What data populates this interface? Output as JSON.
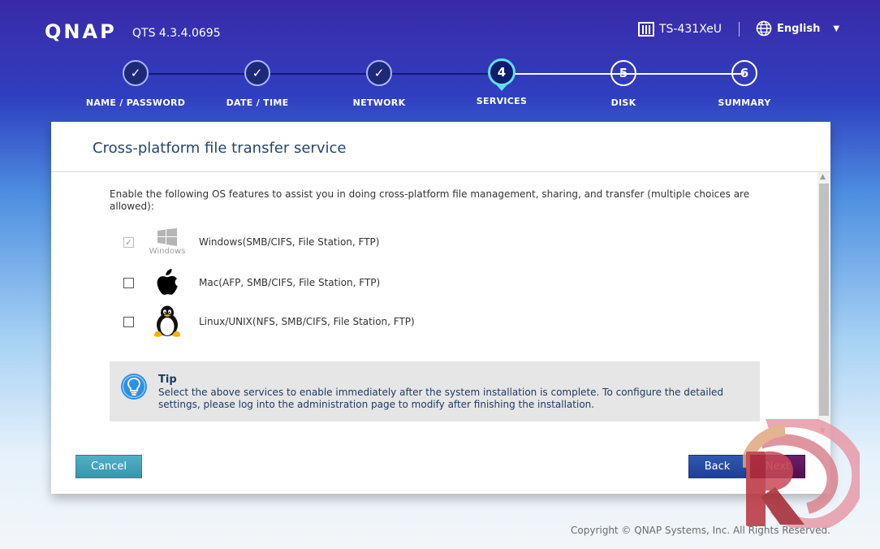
{
  "header": {
    "logo": "QNAP",
    "version": "QTS 4.3.4.0695",
    "device": "TS-431XeU",
    "language": "English"
  },
  "steps": [
    {
      "label": "NAME / PASSWORD",
      "state": "done",
      "mark": "✓"
    },
    {
      "label": "DATE / TIME",
      "state": "done",
      "mark": "✓"
    },
    {
      "label": "NETWORK",
      "state": "done",
      "mark": "✓"
    },
    {
      "label": "SERVICES",
      "state": "active",
      "mark": "4"
    },
    {
      "label": "DISK",
      "state": "todo",
      "mark": "5"
    },
    {
      "label": "SUMMARY",
      "state": "todo",
      "mark": "6"
    }
  ],
  "panel": {
    "title": "Cross-platform file transfer service",
    "intro": "Enable the following OS features to assist you in doing cross-platform file management, sharing, and transfer (multiple choices are allowed):",
    "options": [
      {
        "label": "Windows(SMB/CIFS, File Station, FTP)",
        "checked": true,
        "disabled": true,
        "icon": "windows-icon",
        "caption": "Windows"
      },
      {
        "label": "Mac(AFP, SMB/CIFS, File Station, FTP)",
        "checked": false,
        "disabled": false,
        "icon": "apple-icon"
      },
      {
        "label": "Linux/UNIX(NFS, SMB/CIFS, File Station, FTP)",
        "checked": false,
        "disabled": false,
        "icon": "tux-icon"
      }
    ],
    "tip": {
      "title": "Tip",
      "text": "Select the above services to enable immediately after the system installation is complete. To configure the detailed settings, please log into the administration page to modify after finishing the installation."
    }
  },
  "buttons": {
    "cancel": "Cancel",
    "back": "Back",
    "next": "Next"
  },
  "footer": {
    "copyright": "Copyright © QNAP Systems, Inc. All Rights Reserved."
  },
  "colors": {
    "accent_active": "#5ee0f0",
    "step_done": "#1e2a78",
    "title": "#26456e",
    "cancel": "#3b93ad",
    "back": "#1e3f93"
  }
}
